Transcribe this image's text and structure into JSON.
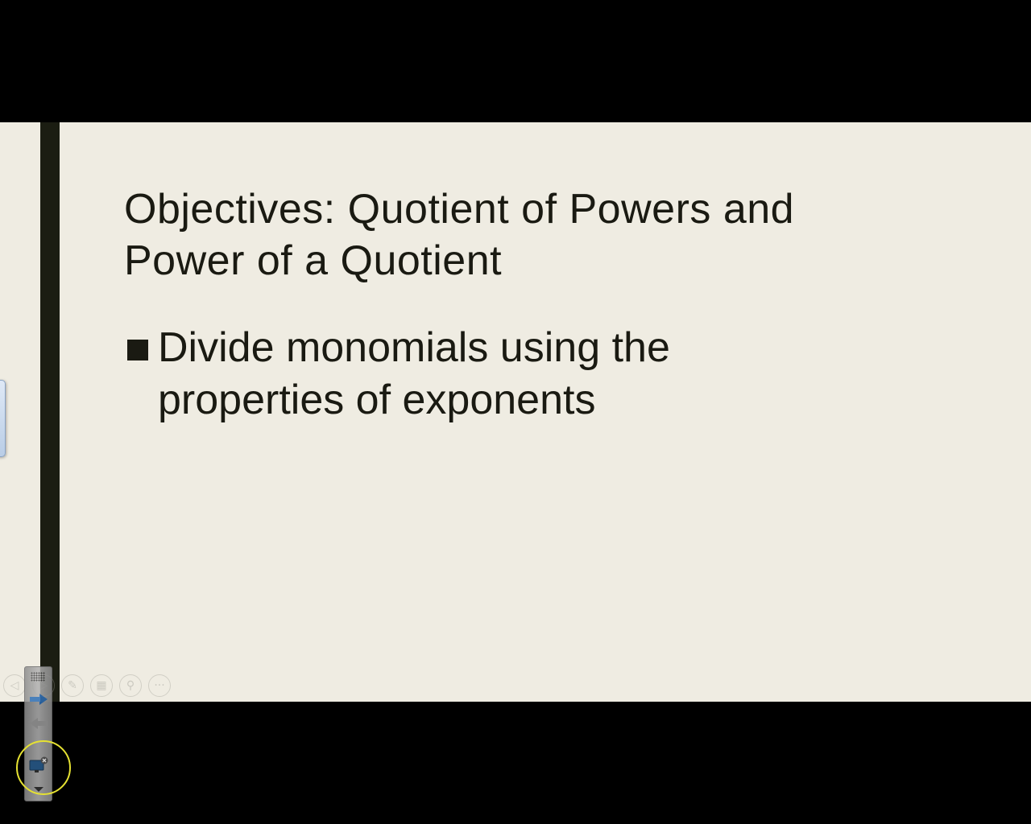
{
  "slide": {
    "title": "Objectives: Quotient of Powers and Power of a Quotient",
    "bullets": [
      "Divide monomials using the properties of exponents"
    ],
    "colors": {
      "background": "#efece2",
      "accent_bar": "#1b1d12",
      "text": "#1a1a12"
    }
  },
  "slideshow_toolbar": {
    "buttons": [
      {
        "name": "previous-slide",
        "icon": "chevron-left-icon",
        "glyph": "◁"
      },
      {
        "name": "next-slide",
        "icon": "chevron-right-icon",
        "glyph": "▷"
      },
      {
        "name": "pen",
        "icon": "pen-icon",
        "glyph": "✎"
      },
      {
        "name": "see-all-slides",
        "icon": "slides-grid-icon",
        "glyph": "▦"
      },
      {
        "name": "zoom",
        "icon": "magnifier-icon",
        "glyph": "⚲"
      },
      {
        "name": "more-options",
        "icon": "more-icon",
        "glyph": "···"
      }
    ]
  },
  "remote_toolbar": {
    "items": [
      {
        "name": "grip",
        "icon": "grip-icon"
      },
      {
        "name": "next",
        "icon": "arrow-right-icon"
      },
      {
        "name": "previous",
        "icon": "arrow-left-icon"
      },
      {
        "name": "screen-share",
        "icon": "monitor-close-icon"
      },
      {
        "name": "expand",
        "icon": "chevron-down-icon"
      }
    ]
  }
}
